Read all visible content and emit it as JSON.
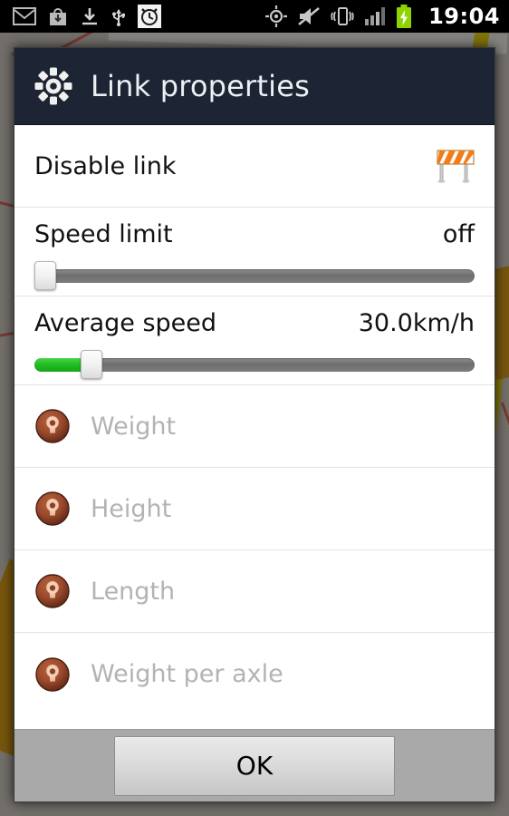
{
  "statusbar": {
    "time": "19:04",
    "left_icons": [
      {
        "name": "gmail-icon",
        "label": "Gmail"
      },
      {
        "name": "play-store-download-icon",
        "label": "App download"
      },
      {
        "name": "download-icon",
        "label": "Download"
      },
      {
        "name": "usb-icon",
        "label": "USB connected"
      },
      {
        "name": "alarm-clock-icon",
        "label": "Alarm set"
      }
    ],
    "right_icons": [
      {
        "name": "gps-location-icon",
        "label": "GPS active"
      },
      {
        "name": "volume-muted-icon",
        "label": "Silent"
      },
      {
        "name": "vibrate-icon",
        "label": "Vibrate"
      },
      {
        "name": "signal-bars-icon",
        "label": "Signal"
      },
      {
        "name": "battery-charging-icon",
        "label": "Battery charging"
      }
    ]
  },
  "dialog": {
    "title": "Link properties",
    "title_icon": "gear-icon",
    "rows": [
      {
        "type": "toggle",
        "name": "disable-link",
        "label": "Disable link",
        "icon": "road-barricade-icon"
      },
      {
        "type": "slider",
        "name": "speed-limit",
        "label": "Speed limit",
        "value": "off",
        "percent": 0,
        "filled": false
      },
      {
        "type": "slider",
        "name": "average-speed",
        "label": "Average speed",
        "value": "30.0km/h",
        "percent": 13,
        "filled": true
      },
      {
        "type": "item",
        "name": "weight",
        "label": "Weight",
        "icon": "restriction-bulb-icon",
        "disabled": true
      },
      {
        "type": "item",
        "name": "height",
        "label": "Height",
        "icon": "restriction-bulb-icon",
        "disabled": true
      },
      {
        "type": "item",
        "name": "length",
        "label": "Length",
        "icon": "restriction-bulb-icon",
        "disabled": true
      },
      {
        "type": "item",
        "name": "weight-per-axle",
        "label": "Weight per axle",
        "icon": "restriction-bulb-icon",
        "disabled": true
      }
    ],
    "ok_label": "OK"
  },
  "colors": {
    "title_bar": "#1d2433",
    "slider_fill": "#1fbc1f",
    "slider_track": "#7c7c7c",
    "disabled_text": "#b3b3b3",
    "footer": "#a9a9a9",
    "battery": "#8fd400",
    "barricade_orange": "#f07d1a"
  }
}
